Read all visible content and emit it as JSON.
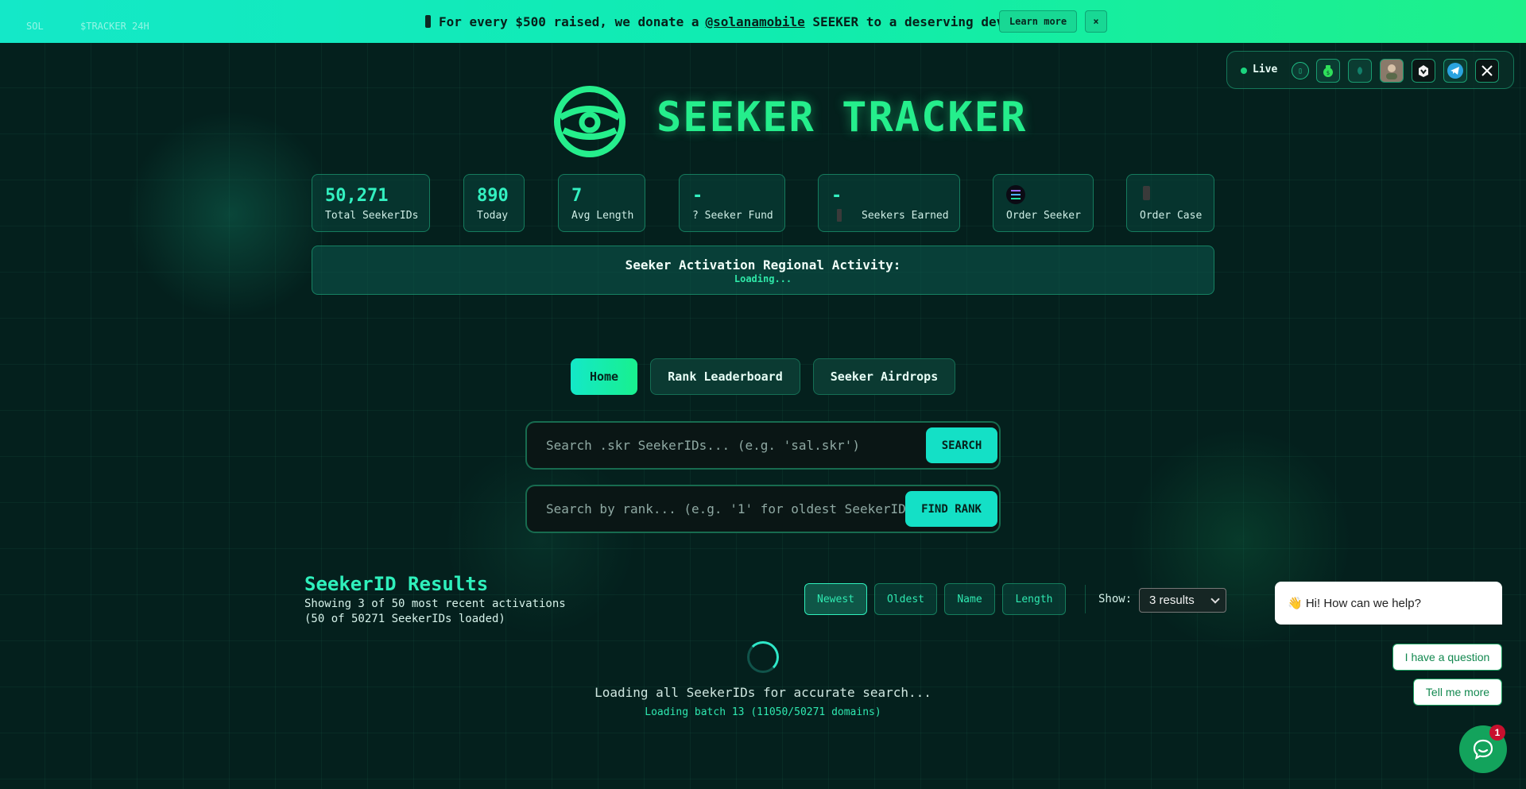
{
  "banner": {
    "ticker_sol": "SOL",
    "ticker_tracker": "$TRACKER 24H",
    "message_prefix": "For every $500 raised, we donate a",
    "mention": "@solanamobile",
    "message_suffix": "SEEKER to a deserving dev",
    "learn_more": "Learn more",
    "close": "×",
    "bg_start": "#14e8c8",
    "bg_end": "#1ef08a"
  },
  "live_panel": {
    "label": "Live",
    "icons": [
      "info-icon",
      "money-bag-icon",
      "leaf-icon",
      "avatar-icon",
      "helmet-icon",
      "telegram-icon",
      "x-icon"
    ]
  },
  "header": {
    "title": "SEEKER TRACKER",
    "accent": "#25ee8c"
  },
  "stats": [
    {
      "value": "50,271",
      "label": "Total SeekerIDs"
    },
    {
      "value": "890",
      "label": "Today"
    },
    {
      "value": "7",
      "label": "Avg Length"
    },
    {
      "value": "-",
      "label": "? Seeker Fund"
    },
    {
      "value": "-",
      "label": "Seekers Earned"
    },
    {
      "value": "",
      "label": "Order Seeker"
    },
    {
      "value": "",
      "label": "Order Case"
    }
  ],
  "regional": {
    "title": "Seeker Activation Regional Activity:",
    "status": "Loading..."
  },
  "nav": {
    "home": "Home",
    "leaderboard": "Rank Leaderboard",
    "airdrops": "Seeker Airdrops"
  },
  "search": {
    "placeholder": "Search .skr SeekerIDs... (e.g. 'sal.skr')",
    "button": "SEARCH"
  },
  "rank_search": {
    "placeholder": "Search by rank... (e.g. '1' for oldest SeekerID)",
    "button": "FIND RANK"
  },
  "results": {
    "title": "SeekerID Results",
    "line1": "Showing 3 of 50 most recent activations",
    "line2": "(50 of 50271 SeekerIDs loaded)",
    "sort": [
      "Newest",
      "Oldest",
      "Name",
      "Length"
    ],
    "show_label": "Show:",
    "show_value": "3 results"
  },
  "loading": {
    "main": "Loading all SeekerIDs for accurate search...",
    "batch": "Loading batch 13 (11050/50271 domains)"
  },
  "chat": {
    "greeting": "👋 Hi! How can we help?",
    "option1": "I have a question",
    "option2": "Tell me more",
    "badge": "1"
  }
}
